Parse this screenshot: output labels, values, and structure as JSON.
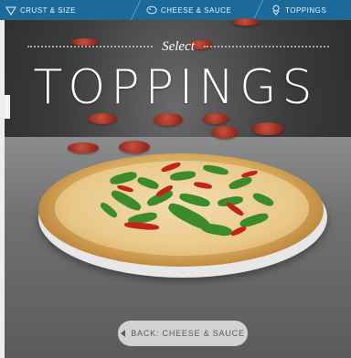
{
  "nav": {
    "crust_label": "CRUST & SIZE",
    "cheese_label": "CHEESE & SAUCE",
    "toppings_label": "TOPPINGS"
  },
  "header": {
    "select_text": "Select",
    "title": "TOPPINGS"
  },
  "back_button": {
    "label": "BACK: CHEESE & SAUCE"
  },
  "icons": [
    "crust-icon",
    "cheese-icon",
    "toppings-icon",
    "back-arrow-icon"
  ],
  "colors": {
    "nav_background": "#1b6a9a",
    "title_color": "#ffffff",
    "button_background": "#e6e6e6"
  }
}
